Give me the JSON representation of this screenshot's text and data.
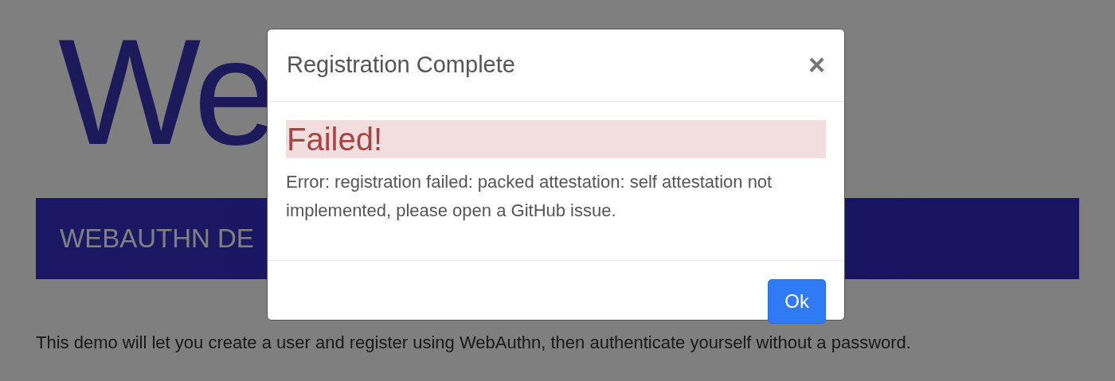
{
  "page": {
    "logo": "We",
    "banner": "WEBAUTHN DE",
    "intro": "This demo will let you create a user and register using WebAuthn, then authenticate yourself without a password."
  },
  "dialog": {
    "title": "Registration Complete",
    "close": "×",
    "alert": {
      "kind": "danger",
      "text": "Failed!"
    },
    "message": "Error: registration failed: packed attestation: self attestation not implemented, please open a GitHub issue.",
    "buttons": [
      "Ok"
    ]
  }
}
